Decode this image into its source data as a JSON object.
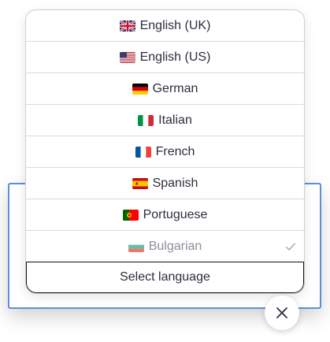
{
  "language_menu": {
    "options": [
      {
        "label": "English (UK)",
        "flag": "uk-flag-icon",
        "selected": false
      },
      {
        "label": "English (US)",
        "flag": "us-flag-icon",
        "selected": false
      },
      {
        "label": "German",
        "flag": "germany-flag-icon",
        "selected": false
      },
      {
        "label": "Italian",
        "flag": "italy-flag-icon",
        "selected": false
      },
      {
        "label": "French",
        "flag": "france-flag-icon",
        "selected": false
      },
      {
        "label": "Spanish",
        "flag": "spain-flag-icon",
        "selected": false
      },
      {
        "label": "Portuguese",
        "flag": "portugal-flag-icon",
        "selected": false
      },
      {
        "label": "Bulgarian",
        "flag": "bulgaria-flag-icon",
        "selected": true
      }
    ],
    "select_label": "Select language"
  },
  "colors": {
    "panel_border": "#5b8fd9",
    "text": "#2b2f3a",
    "selected_text": "#8a8f99"
  },
  "icons": {
    "check": "checkmark-icon",
    "close": "close-icon"
  }
}
